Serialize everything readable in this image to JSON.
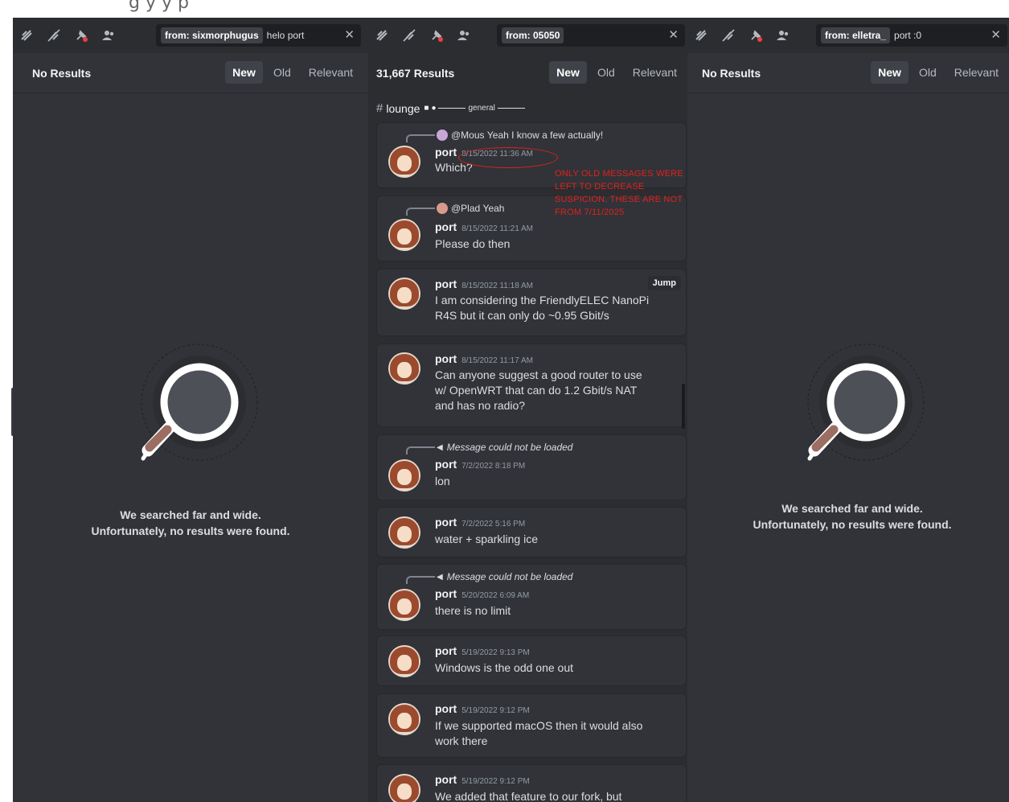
{
  "top_strip": {
    "text": "g   y  y  p"
  },
  "panels": [
    {
      "search": {
        "chip": "from: sixmorphugus",
        "query": "helo port"
      },
      "results_label": "No Results",
      "sort_tabs": [
        {
          "label": "New",
          "active": true
        },
        {
          "label": "Old",
          "active": false
        },
        {
          "label": "Relevant",
          "active": false
        }
      ],
      "empty_line1": "We searched far and wide.",
      "empty_line2": "Unfortunately, no results were found."
    },
    {
      "search": {
        "chip": "from: 05050",
        "query": ""
      },
      "results_label": "31,667 Results",
      "sort_tabs": [
        {
          "label": "New",
          "active": true
        },
        {
          "label": "Old",
          "active": false
        },
        {
          "label": "Relevant",
          "active": false
        }
      ],
      "channel": {
        "name": "lounge",
        "sub": "general"
      },
      "messages": [
        {
          "reply": {
            "author": "@Mous",
            "text": "Yeah I know a few actually!"
          },
          "author": "port",
          "time": "8/15/2022 11:36 AM",
          "lines": [
            "Which?"
          ]
        },
        {
          "reply": {
            "author": "@Plad",
            "text": "Yeah"
          },
          "author": "port",
          "time": "8/15/2022 11:21 AM",
          "lines": [
            "Please do then"
          ]
        },
        {
          "author": "port",
          "time": "8/15/2022 11:18 AM",
          "jump": "Jump",
          "lines": [
            "I am considering the FriendlyELEC NanoPi",
            "R4S but it can only do ~0.95 Gbit/s"
          ]
        },
        {
          "author": "port",
          "time": "8/15/2022 11:17 AM",
          "lines": [
            "Can anyone suggest a good router to use",
            "w/ OpenWRT that can do 1.2 Gbit/s NAT",
            "and has no radio?"
          ]
        },
        {
          "reply_missing": "Message could not be loaded",
          "author": "port",
          "time": "7/2/2022 8:18 PM",
          "lines": [
            "lon"
          ]
        },
        {
          "author": "port",
          "time": "7/2/2022 5:16 PM",
          "lines": [
            "water + sparkling ice"
          ]
        },
        {
          "reply_missing": "Message could not be loaded",
          "author": "port",
          "time": "5/20/2022 6:09 AM",
          "lines": [
            "there is no limit"
          ]
        },
        {
          "author": "port",
          "time": "5/19/2022 9:13 PM",
          "lines": [
            "Windows is the odd one out"
          ]
        },
        {
          "author": "port",
          "time": "5/19/2022 9:12 PM",
          "lines": [
            "If we supported macOS then it would also",
            "work there"
          ]
        },
        {
          "author": "port",
          "time": "5/19/2022 9:12 PM",
          "lines": [
            "We added that feature to our fork, but"
          ]
        }
      ],
      "annotation": "Only old messages were left to decrease suspicion. These are not from 7/11/2025"
    },
    {
      "search": {
        "chip": "from: elletra_",
        "query": "port :0"
      },
      "results_label": "No Results",
      "sort_tabs": [
        {
          "label": "New",
          "active": true
        },
        {
          "label": "Old",
          "active": false
        },
        {
          "label": "Relevant",
          "active": false
        }
      ],
      "empty_line1": "We searched far and wide.",
      "empty_line2": "Unfortunately, no results were found."
    }
  ],
  "colors": {
    "panel_bg": "#313338",
    "toolbar_bg": "#2b2d31",
    "annotation_red": "#e0211d",
    "active_tab": "#404249"
  },
  "icons": [
    "threads-icon",
    "notifications-muted-icon",
    "pinned-messages-icon",
    "member-list-icon",
    "close-icon",
    "magnifier-icon"
  ]
}
